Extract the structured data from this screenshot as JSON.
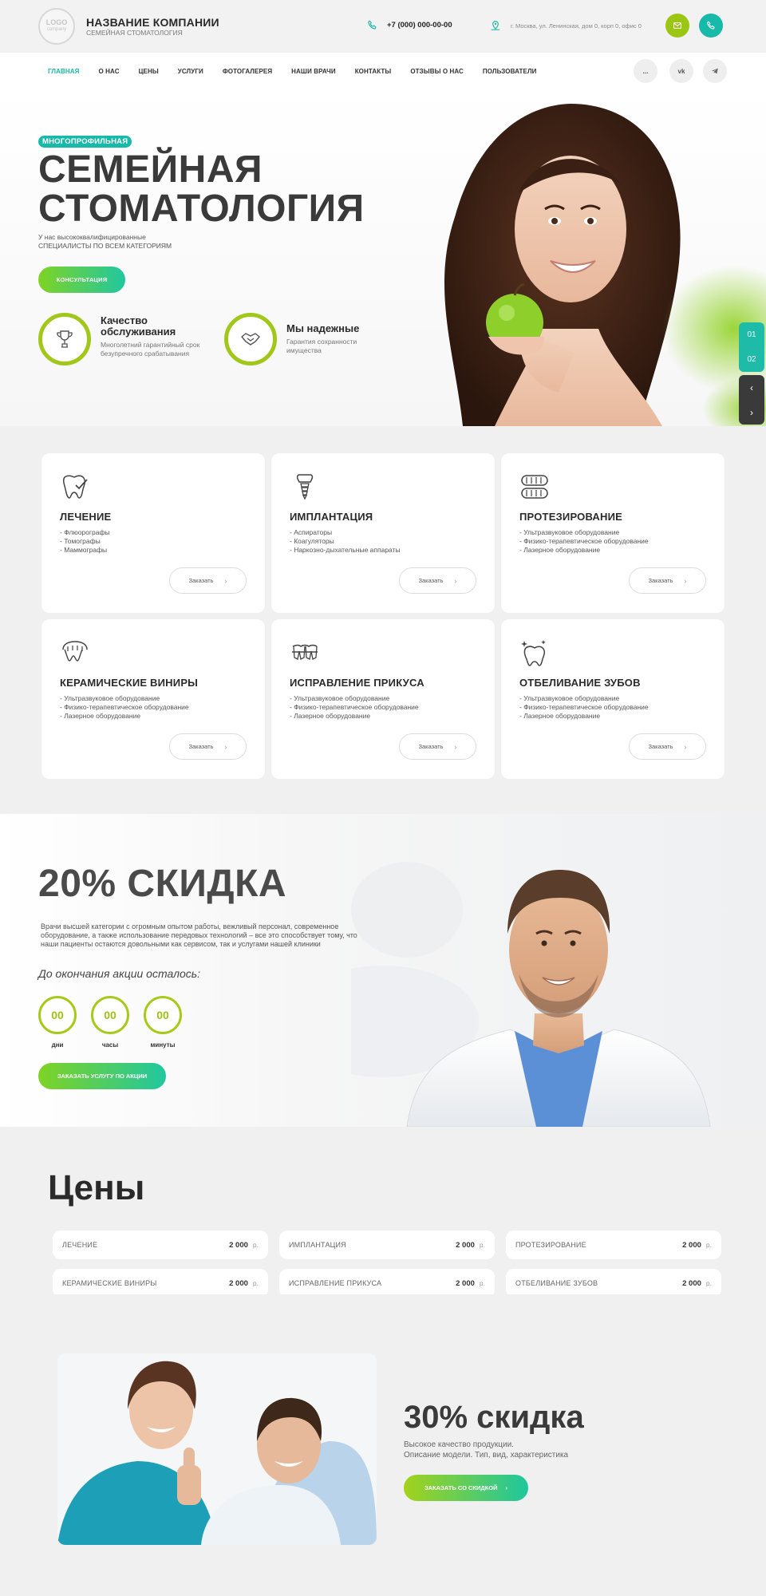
{
  "header": {
    "logo_text": "LOGO",
    "logo_sub": "company",
    "company_name": "НАЗВАНИЕ КОМПАНИИ",
    "company_sub": "СЕМЕЙНАЯ СТОМАТОЛОГИЯ",
    "phone": "+7 (000) 000-00-00",
    "address": "г. Москва, ул. Ленинская, дом 0, корп 0, офис 0",
    "accent_colors": {
      "green": "#9bc613",
      "teal": "#17b9a9"
    }
  },
  "nav": {
    "items": [
      {
        "label": "ГЛАВНАЯ"
      },
      {
        "label": "О НАС"
      },
      {
        "label": "ЦЕНЫ"
      },
      {
        "label": "УСЛУГИ"
      },
      {
        "label": "ФОТОГАЛЕРЕЯ"
      },
      {
        "label": "НАШИ ВРАЧИ"
      },
      {
        "label": "КОНТАКТЫ"
      },
      {
        "label": "ОТЗЫВЫ О НАС"
      },
      {
        "label": "ПОЛЬЗОВАТЕЛИ"
      }
    ],
    "more_label": "...",
    "vk_label": "vk"
  },
  "hero": {
    "badge": "МНОГОПРОФИЛЬНАЯ",
    "title_line1": "СЕМЕЙНАЯ",
    "title_line2": "СТОМАТОЛОГИЯ",
    "text_line1": "У нас высококвалифицированные",
    "text_line2": "СПЕЦИАЛИСТЫ ПО ВСЕМ КАТЕГОРИЯМ",
    "cta": "КОНСУЛЬТАЦИЯ",
    "features": [
      {
        "title_line1": "Качество",
        "title_line2": "обслуживания",
        "text": "Многолетний гарантийный срок безупречного срабатывания",
        "icon": "trophy-icon"
      },
      {
        "title_line1": "Мы надежные",
        "title_line2": "",
        "text": "Гарантия сохранности имущества",
        "icon": "handshake-icon"
      }
    ],
    "pager": [
      "01",
      "02"
    ],
    "arrow_prev": "‹",
    "arrow_next": "›"
  },
  "services": {
    "button_label": "Заказать",
    "items": [
      {
        "title": "ЛЕЧЕНИЕ",
        "icon": "tooth-check-icon",
        "lines": [
          "- Флюорографы",
          "- Томографы",
          "- Маммографы"
        ]
      },
      {
        "title": "ИМПЛАНТАЦИЯ",
        "icon": "implant-icon",
        "lines": [
          "- Аспираторы",
          "- Коагуляторы",
          "- Наркозно-дыхательные аппараты"
        ]
      },
      {
        "title": "ПРОТЕЗИРОВАНИЕ",
        "icon": "denture-icon",
        "lines": [
          "- Ультразвуковое оборудование",
          "- Физико-терапевтическое оборудование",
          "- Лазерное оборудование"
        ]
      },
      {
        "title": "КЕРАМИЧЕСКИЕ ВИНИРЫ",
        "icon": "veneer-icon",
        "lines": [
          "- Ультразвуковое оборудование",
          "- Физико-терапевтическое оборудование",
          "- Лазерное оборудование"
        ]
      },
      {
        "title": "ИСПРАВЛЕНИЕ ПРИКУСА",
        "icon": "braces-icon",
        "lines": [
          "- Ультразвуковое оборудование",
          "- Физико-терапевтическое оборудование",
          "- Лазерное оборудование"
        ]
      },
      {
        "title": "ОТБЕЛИВАНИЕ ЗУБОВ",
        "icon": "whitening-icon",
        "lines": [
          "- Ультразвуковое оборудование",
          "- Физико-терапевтическое оборудование",
          "- Лазерное оборудование"
        ]
      }
    ]
  },
  "sale": {
    "title": "20% СКИДКА",
    "text": "Врачи высшей категории с огромным опытом работы, вежливый персонал, современное оборудование, а также использование передовых технологий – все это способствует тому, что наши пациенты остаются довольными как сервисом, так и услугами нашей клиники",
    "until": "До окончания акции осталось:",
    "timer": [
      {
        "value": "00",
        "label": "дни"
      },
      {
        "value": "00",
        "label": "часы"
      },
      {
        "value": "00",
        "label": "минуты"
      }
    ],
    "cta": "ЗАКАЗАТЬ УСЛУГУ ПО АКЦИИ"
  },
  "prices": {
    "title": "Цены",
    "unit": "р.",
    "items": [
      {
        "name": "ЛЕЧЕНИЕ",
        "price": "2 000"
      },
      {
        "name": "ИМПЛАНТАЦИЯ",
        "price": "2 000"
      },
      {
        "name": "ПРОТЕЗИРОВАНИЕ",
        "price": "2 000"
      },
      {
        "name": "КЕРАМИЧЕСКИЕ ВИНИРЫ",
        "price": "2 000"
      },
      {
        "name": "ИСПРАВЛЕНИЕ ПРИКУСА",
        "price": "2 000"
      },
      {
        "name": "ОТБЕЛИВАНИЕ ЗУБОВ",
        "price": "2 000"
      }
    ]
  },
  "promo": {
    "title": "30% скидка",
    "text_line1": "Высокое качество продукции.",
    "text_line2": "Описание модели. Тип, вид, характеристика",
    "cta": "ЗАКАЗАТЬ СО СКИДКОЙ"
  }
}
